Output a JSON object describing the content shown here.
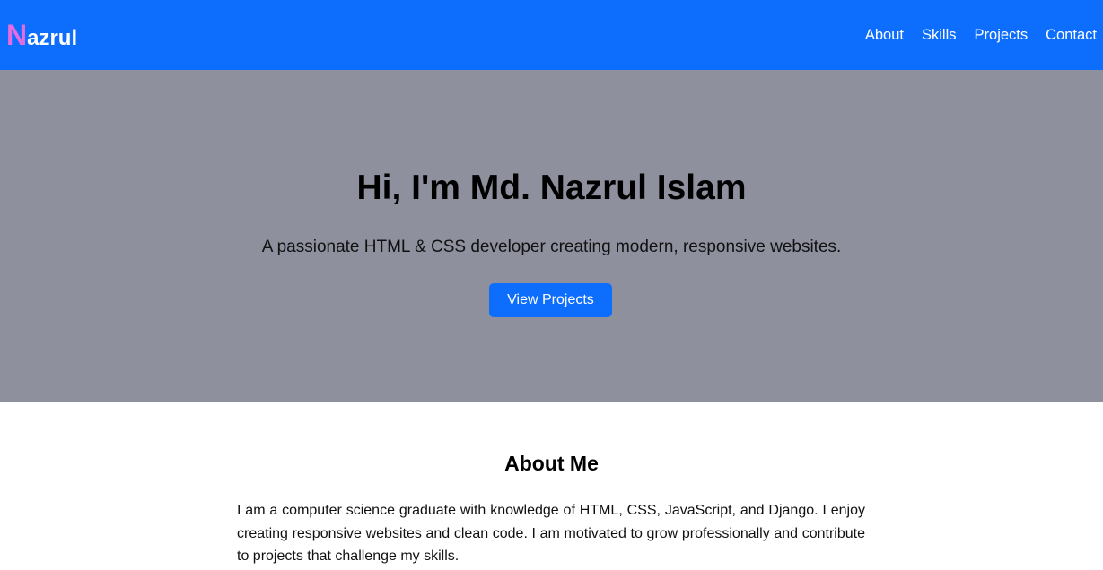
{
  "navbar": {
    "brand_first": "N",
    "brand_rest": "azrul",
    "links": [
      "About",
      "Skills",
      "Projects",
      "Contact"
    ]
  },
  "hero": {
    "title": "Hi, I'm Md. Nazrul Islam",
    "subtitle": "A passionate HTML & CSS developer creating modern, responsive websites.",
    "button_label": "View Projects"
  },
  "about": {
    "title": "About Me",
    "text": "I am a computer science graduate with knowledge of HTML, CSS, JavaScript, and Django. I enjoy creating responsive websites and clean code. I am motivated to grow professionally and contribute to projects that challenge my skills."
  },
  "colors": {
    "navbar_bg": "#0d6efd",
    "brand_accent": "#e46be0",
    "hero_bg": "#8e909e",
    "button_bg": "#0d6efd"
  }
}
